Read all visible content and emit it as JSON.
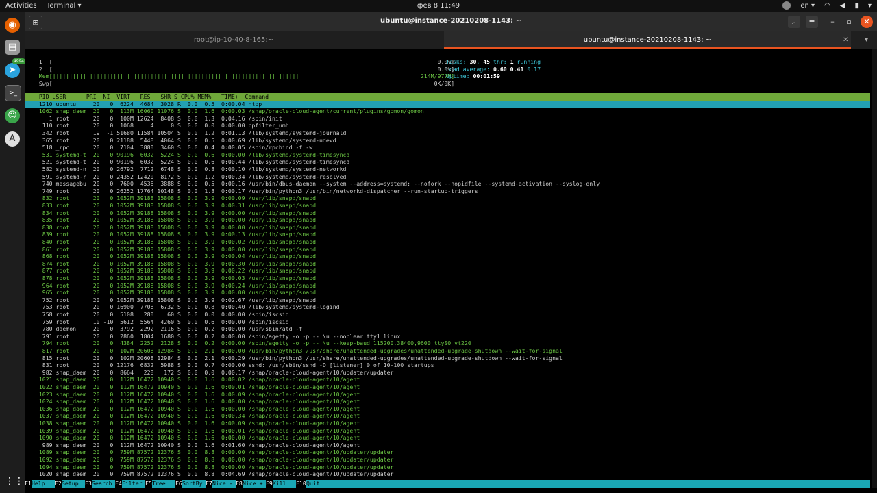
{
  "topbar": {
    "activities": "Activities",
    "app_menu": "Terminal ▾",
    "clock": "фев 8  11:49",
    "lang": "en ▾"
  },
  "window": {
    "title": "ubuntu@instance-20210208-1143: ~"
  },
  "tabs": [
    {
      "label": "root@ip-10-40-8-165:~"
    },
    {
      "label": "ubuntu@instance-20210208-1143: ~"
    }
  ],
  "dock": {
    "telegram_badge": "4994"
  },
  "htop": {
    "meters": {
      "cpu1": "  1  [                                                                                                                  0.0%]",
      "cpu2": "  2  [                                                                                                                  0.0%]",
      "mem": "  Mem[|||||||||||||||||||||||||||||||||||||||||||||||||||||||||||||||||||||||||                                    214M/977M]",
      "swp": "  Swp[                                                                                                                 0K/0K]"
    },
    "tasks": [
      "Tasks: ",
      "30",
      ", ",
      "45",
      " thr; ",
      "1",
      " running"
    ],
    "load": [
      "Load average: ",
      "0.60",
      " ",
      "0.41",
      " ",
      "0.17"
    ],
    "uptime": [
      "Uptime: ",
      "00:01:59"
    ],
    "header": "  PID USER      PRI  NI  VIRT   RES   SHR S CPU% MEM%   TIME+  Command",
    "rows": [
      "  1210 ubuntu     20   0  6224  4684  3028 R  0.0  0.5  0:00.04 htop",
      "  1062 snap_daem  20   0  113M 16060 11076 S  0.0  1.6  0:00.03 /snap/oracle-cloud-agent/current/plugins/gomon/gomon",
      "     1 root       20   0  100M 12624  8408 S  0.0  1.3  0:04.16 /sbin/init",
      "   110 root       20   0  1068     4     0 S  0.0  0.0  0:00.00 bpfilter_umh",
      "   342 root       19  -1 51680 11584 10504 S  0.0  1.2  0:01.13 /lib/systemd/systemd-journald",
      "   365 root       20   0 21188  5448  4064 S  0.0  0.5  0:00.69 /lib/systemd/systemd-udevd",
      "   518 _rpc       20   0  7104  3880  3460 S  0.0  0.4  0:00.05 /sbin/rpcbind -f -w",
      "   531 systemd-t  20   0 90196  6032  5224 S  0.0  0.6  0:00.00 /lib/systemd/systemd-timesyncd",
      "   521 systemd-t  20   0 90196  6032  5224 S  0.0  0.6  0:00.44 /lib/systemd/systemd-timesyncd",
      "   582 systemd-n  20   0 26792  7712  6748 S  0.0  0.8  0:00.10 /lib/systemd/systemd-networkd",
      "   591 systemd-r  20   0 24352 12420  8172 S  0.0  1.2  0:00.34 /lib/systemd/systemd-resolved",
      "   740 messagebu  20   0  7600  4536  3888 S  0.0  0.5  0:00.16 /usr/bin/dbus-daemon --system --address=systemd: --nofork --nopidfile --systemd-activation --syslog-only",
      "   749 root       20   0 26252 17764 10148 S  0.0  1.8  0:00.17 /usr/bin/python3 /usr/bin/networkd-dispatcher --run-startup-triggers",
      "   832 root       20   0 1052M 39188 15808 S  0.0  3.9  0:00.09 /usr/lib/snapd/snapd",
      "   833 root       20   0 1052M 39188 15808 S  0.0  3.9  0:00.31 /usr/lib/snapd/snapd",
      "   834 root       20   0 1052M 39188 15808 S  0.0  3.9  0:00.00 /usr/lib/snapd/snapd",
      "   835 root       20   0 1052M 39188 15808 S  0.0  3.9  0:00.00 /usr/lib/snapd/snapd",
      "   838 root       20   0 1052M 39188 15808 S  0.0  3.9  0:00.00 /usr/lib/snapd/snapd",
      "   839 root       20   0 1052M 39188 15808 S  0.0  3.9  0:00.13 /usr/lib/snapd/snapd",
      "   840 root       20   0 1052M 39188 15808 S  0.0  3.9  0:00.02 /usr/lib/snapd/snapd",
      "   861 root       20   0 1052M 39188 15808 S  0.0  3.9  0:00.00 /usr/lib/snapd/snapd",
      "   868 root       20   0 1052M 39188 15808 S  0.0  3.9  0:00.04 /usr/lib/snapd/snapd",
      "   874 root       20   0 1052M 39188 15808 S  0.0  3.9  0:00.30 /usr/lib/snapd/snapd",
      "   877 root       20   0 1052M 39188 15808 S  0.0  3.9  0:00.22 /usr/lib/snapd/snapd",
      "   878 root       20   0 1052M 39188 15808 S  0.0  3.9  0:00.03 /usr/lib/snapd/snapd",
      "   964 root       20   0 1052M 39188 15808 S  0.0  3.9  0:00.24 /usr/lib/snapd/snapd",
      "   965 root       20   0 1052M 39188 15808 S  0.0  3.9  0:00.00 /usr/lib/snapd/snapd",
      "   752 root       20   0 1052M 39188 15808 S  0.0  3.9  0:02.67 /usr/lib/snapd/snapd",
      "   753 root       20   0 16900  7708  6732 S  0.0  0.8  0:00.40 /lib/systemd/systemd-logind",
      "   758 root       20   0  5108   280    60 S  0.0  0.0  0:00.00 /sbin/iscsid",
      "   759 root       10 -10  5612  5564  4260 S  0.0  0.6  0:00.00 /sbin/iscsid",
      "   780 daemon     20   0  3792  2292  2116 S  0.0  0.2  0:00.00 /usr/sbin/atd -f",
      "   791 root       20   0  2860  1804  1680 S  0.0  0.2  0:00.00 /sbin/agetty -o -p -- \\u --noclear tty1 linux",
      "   794 root       20   0  4384  2252  2128 S  0.0  0.2  0:00.00 /sbin/agetty -o -p -- \\u --keep-baud 115200,38400,9600 ttyS0 vt220",
      "   817 root       20   0  102M 20608 12984 S  0.0  2.1  0:00.00 /usr/bin/python3 /usr/share/unattended-upgrades/unattended-upgrade-shutdown --wait-for-signal",
      "   815 root       20   0  102M 20608 12984 S  0.0  2.1  0:00.29 /usr/bin/python3 /usr/share/unattended-upgrades/unattended-upgrade-shutdown --wait-for-signal",
      "   831 root       20   0 12176  6832  5988 S  0.0  0.7  0:00.00 sshd: /usr/sbin/sshd -D [listener] 0 of 10-100 startups",
      "   982 snap_daem  20   0  8664   228   172 S  0.0  0.0  0:00.17 /snap/oracle-cloud-agent/10/updater/updater",
      "  1021 snap_daem  20   0  112M 16472 10940 S  0.0  1.6  0:00.02 /snap/oracle-cloud-agent/10/agent",
      "  1022 snap_daem  20   0  112M 16472 10940 S  0.0  1.6  0:00.01 /snap/oracle-cloud-agent/10/agent",
      "  1023 snap_daem  20   0  112M 16472 10940 S  0.0  1.6  0:00.09 /snap/oracle-cloud-agent/10/agent",
      "  1024 snap_daem  20   0  112M 16472 10940 S  0.0  1.6  0:00.00 /snap/oracle-cloud-agent/10/agent",
      "  1036 snap_daem  20   0  112M 16472 10940 S  0.0  1.6  0:00.00 /snap/oracle-cloud-agent/10/agent",
      "  1037 snap_daem  20   0  112M 16472 10940 S  0.0  1.6  0:00.34 /snap/oracle-cloud-agent/10/agent",
      "  1038 snap_daem  20   0  112M 16472 10940 S  0.0  1.6  0:00.09 /snap/oracle-cloud-agent/10/agent",
      "  1039 snap_daem  20   0  112M 16472 10940 S  0.0  1.6  0:00.01 /snap/oracle-cloud-agent/10/agent",
      "  1090 snap_daem  20   0  112M 16472 10940 S  0.0  1.6  0:00.00 /snap/oracle-cloud-agent/10/agent",
      "   989 snap_daem  20   0  112M 16472 10940 S  0.0  1.6  0:01.60 /snap/oracle-cloud-agent/10/agent",
      "  1089 snap_daem  20   0  759M 87572 12376 S  0.0  8.8  0:00.00 /snap/oracle-cloud-agent/10/updater/updater",
      "  1092 snap_daem  20   0  759M 87572 12376 S  0.0  8.8  0:00.00 /snap/oracle-cloud-agent/10/updater/updater",
      "  1094 snap_daem  20   0  759M 87572 12376 S  0.0  8.8  0:00.00 /snap/oracle-cloud-agent/10/updater/updater",
      "  1020 snap_daem  20   0  759M 87572 12376 S  0.0  8.8  0:04.69 /snap/oracle-cloud-agent/10/updater/updater"
    ],
    "fkeys": [
      {
        "key": "F1",
        "label": "Help  "
      },
      {
        "key": "F2",
        "label": "Setup "
      },
      {
        "key": "F3",
        "label": "Search"
      },
      {
        "key": "F4",
        "label": "Filter"
      },
      {
        "key": "F5",
        "label": "Tree  "
      },
      {
        "key": "F6",
        "label": "SortBy"
      },
      {
        "key": "F7",
        "label": "Nice -"
      },
      {
        "key": "F8",
        "label": "Nice +"
      },
      {
        "key": "F9",
        "label": "Kill  "
      },
      {
        "key": "F10",
        "label": "Quit  "
      }
    ]
  }
}
